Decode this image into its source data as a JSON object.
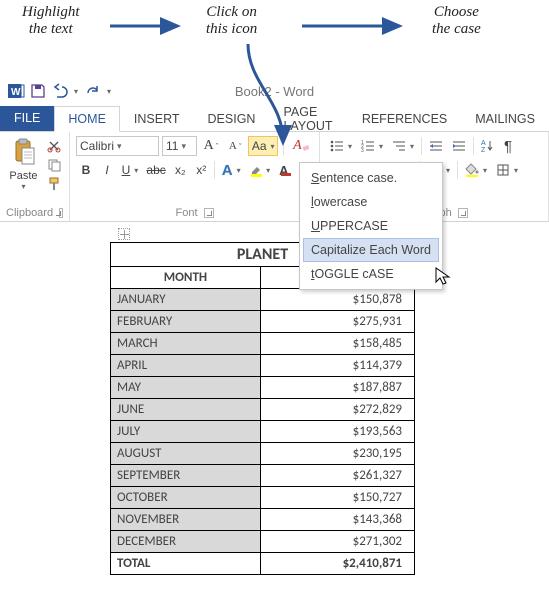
{
  "annotations": {
    "step1": "Highlight\nthe text",
    "step2": "Click on\nthis icon",
    "step3": "Choose\nthe case"
  },
  "titlebar": {
    "doc_title": "Book2 - Word"
  },
  "tabs": {
    "file": "FILE",
    "home": "HOME",
    "insert": "INSERT",
    "design": "DESIGN",
    "page_layout": "PAGE LAYOUT",
    "references": "REFERENCES",
    "mailings": "MAILINGS"
  },
  "ribbon": {
    "clipboard": {
      "paste": "Paste",
      "label": "Clipboard"
    },
    "font": {
      "name": "Calibri",
      "size": "11",
      "bold": "B",
      "italic": "I",
      "underline": "U",
      "strike": "abc",
      "sub": "x₂",
      "sup": "x²",
      "change_case_glyph": "Aa",
      "label": "Font"
    },
    "paragraph": {
      "label": "Paragraph"
    }
  },
  "change_case_menu": {
    "sentence": "Sentence case.",
    "lower": "lowercase",
    "upper": "UPPERCASE",
    "cap_each": "Capitalize Each Word",
    "toggle": "tOGGLE cASE"
  },
  "chart_data": {
    "type": "table",
    "title": "PLANET",
    "columns": [
      "MONTH",
      ""
    ],
    "rows": [
      {
        "month": "JANUARY",
        "value": "$150,878"
      },
      {
        "month": "FEBRUARY",
        "value": "$275,931"
      },
      {
        "month": "MARCH",
        "value": "$158,485"
      },
      {
        "month": "APRIL",
        "value": "$114,379"
      },
      {
        "month": "MAY",
        "value": "$187,887"
      },
      {
        "month": "JUNE",
        "value": "$272,829"
      },
      {
        "month": "JULY",
        "value": "$193,563"
      },
      {
        "month": "AUGUST",
        "value": "$230,195"
      },
      {
        "month": "SEPTEMBER",
        "value": "$261,327"
      },
      {
        "month": "OCTOBER",
        "value": "$150,727"
      },
      {
        "month": "NOVEMBER",
        "value": "$143,368"
      },
      {
        "month": "DECEMBER",
        "value": "$271,302"
      }
    ],
    "total": {
      "label": "TOTAL",
      "value": "$2,410,871"
    }
  }
}
